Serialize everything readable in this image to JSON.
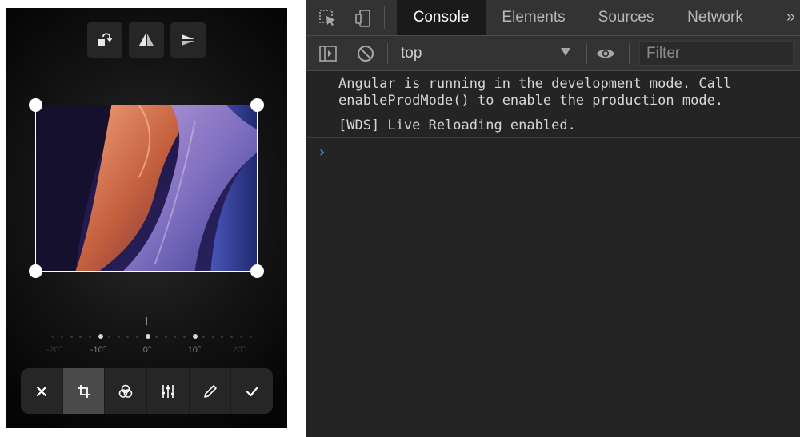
{
  "editor": {
    "top_tools": [
      {
        "icon": "rotate-icon"
      },
      {
        "icon": "flip-horizontal-icon"
      },
      {
        "icon": "flip-vertical-icon"
      }
    ],
    "rotation": {
      "value_degrees": 0,
      "labels": [
        "-20°",
        "-10°",
        "0°",
        "10°",
        "20°"
      ]
    },
    "bottom_bar": [
      {
        "icon": "close-icon"
      },
      {
        "icon": "crop-icon",
        "active": true
      },
      {
        "icon": "filters-icon"
      },
      {
        "icon": "sliders-icon"
      },
      {
        "icon": "pencil-icon"
      },
      {
        "icon": "check-icon"
      }
    ]
  },
  "devtools": {
    "tabs": [
      "Console",
      "Elements",
      "Sources",
      "Network"
    ],
    "active_tab": "Console",
    "more_label": "»",
    "context": "top",
    "filter": {
      "placeholder": "Filter",
      "value": ""
    },
    "messages": [
      "Angular is running in the development mode. Call enableProdMode() to enable the production mode.",
      "[WDS] Live Reloading enabled."
    ],
    "prompt": "›",
    "colors": {
      "prompt": "#4a8cf0",
      "panel": "#242424",
      "toolbar": "#333333"
    }
  }
}
